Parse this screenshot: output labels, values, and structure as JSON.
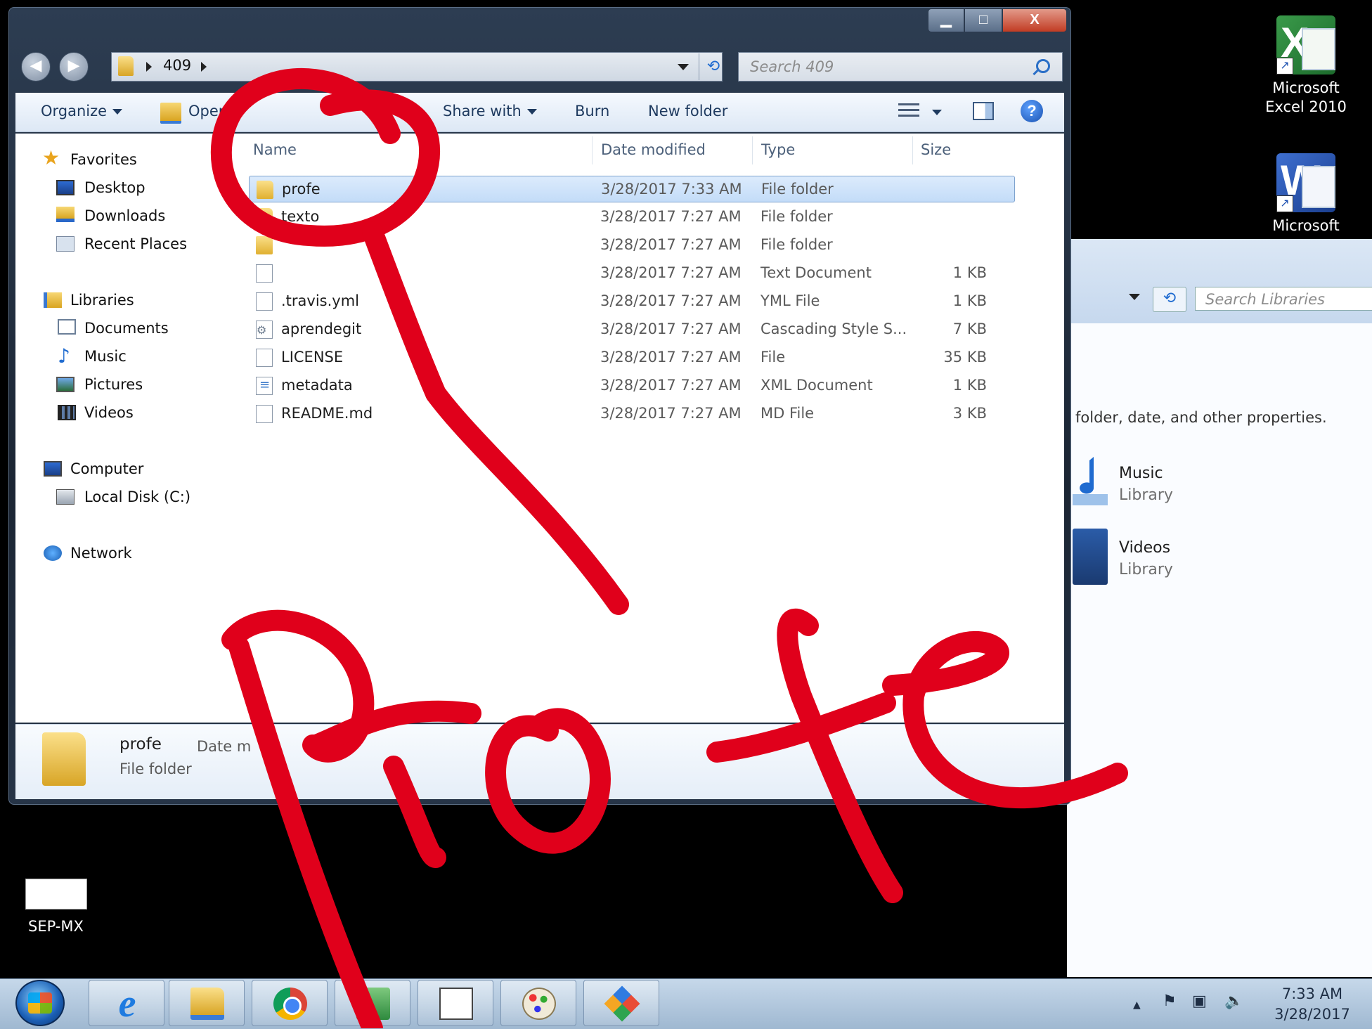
{
  "window": {
    "caption_min": "▁",
    "caption_max": "□",
    "caption_close": "X",
    "breadcrumb": [
      "409"
    ],
    "search_placeholder": "Search 409"
  },
  "toolbar": {
    "organize": "Organize",
    "open": "Open",
    "share_with": "Share with",
    "burn": "Burn",
    "new_folder": "New folder"
  },
  "nav": {
    "favorites": "Favorites",
    "desktop": "Desktop",
    "downloads": "Downloads",
    "recent_places": "Recent Places",
    "libraries": "Libraries",
    "documents": "Documents",
    "music": "Music",
    "pictures": "Pictures",
    "videos": "Videos",
    "computer": "Computer",
    "local_disk": "Local Disk (C:)",
    "network": "Network"
  },
  "columns": {
    "name": "Name",
    "date": "Date modified",
    "type": "Type",
    "size": "Size"
  },
  "files": [
    {
      "name": "profe",
      "date": "3/28/2017 7:33 AM",
      "type": "File folder",
      "size": "",
      "icon": "folder-icon"
    },
    {
      "name": "texto",
      "date": "3/28/2017 7:27 AM",
      "type": "File folder",
      "size": "",
      "icon": "folder-icon"
    },
    {
      "name": "",
      "date": "3/28/2017 7:27 AM",
      "type": "File folder",
      "size": "",
      "icon": "folder-icon"
    },
    {
      "name": "",
      "date": "3/28/2017 7:27 AM",
      "type": "Text Document",
      "size": "1 KB",
      "icon": "text-file-icon"
    },
    {
      "name": ".travis.yml",
      "date": "3/28/2017 7:27 AM",
      "type": "YML File",
      "size": "1 KB",
      "icon": "file-icon"
    },
    {
      "name": "aprendegit",
      "date": "3/28/2017 7:27 AM",
      "type": "Cascading Style S...",
      "size": "7 KB",
      "icon": "css-file-icon"
    },
    {
      "name": "LICENSE",
      "date": "3/28/2017 7:27 AM",
      "type": "File",
      "size": "35 KB",
      "icon": "file-icon"
    },
    {
      "name": "metadata",
      "date": "3/28/2017 7:27 AM",
      "type": "XML Document",
      "size": "1 KB",
      "icon": "xml-file-icon"
    },
    {
      "name": "README.md",
      "date": "3/28/2017 7:27 AM",
      "type": "MD File",
      "size": "3 KB",
      "icon": "file-icon"
    }
  ],
  "details": {
    "name": "profe",
    "type": "File folder",
    "date_label": "Date m"
  },
  "desktop_icons": {
    "excel_line1": "Microsoft",
    "excel_line2": "Excel 2010",
    "word_line1": "Microsoft",
    "sep": "SEP-MX"
  },
  "background_window": {
    "search_placeholder": "Search Libraries",
    "hint": "folder, date, and other properties.",
    "music_title": "Music",
    "music_sub": "Library",
    "videos_title": "Videos",
    "videos_sub": "Library"
  },
  "taskbar": {
    "tray_up": "▲",
    "clock_time": "7:33 AM",
    "clock_date": "3/28/2017"
  },
  "annotation": {
    "color": "#e0001b"
  }
}
